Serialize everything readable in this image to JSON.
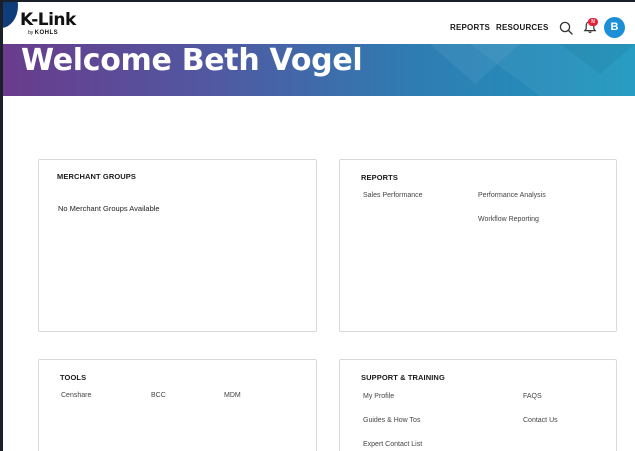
{
  "header": {
    "logo_main": "K-Link",
    "logo_prefix": "by",
    "logo_brand": "KOHLS",
    "nav": [
      "REPORTS",
      "RESOURCES"
    ],
    "notification_badge": "N",
    "avatar_initial": "B",
    "icons": [
      "search-icon",
      "bell-icon"
    ]
  },
  "banner": {
    "title": "Welcome Beth Vogel"
  },
  "merchant_groups": {
    "title": "MERCHANT GROUPS",
    "empty_text": "No Merchant Groups Available"
  },
  "reports": {
    "title": "REPORTS",
    "links": [
      "Sales Performance",
      "Performance Analysis",
      "Workflow Reporting"
    ]
  },
  "tools": {
    "title": "TOOLS",
    "links": [
      "Censhare",
      "BCC",
      "MDM"
    ]
  },
  "support": {
    "title": "SUPPORT & TRAINING",
    "links": [
      "My Profile",
      "FAQS",
      "Guides & How Tos",
      "Contact Us",
      "Expert Contact List"
    ]
  },
  "colors": {
    "accent_blue": "#1d8fd6",
    "badge_red": "#e3223a",
    "banner_start": "#6a3b8d",
    "banner_end": "#1d98bf"
  }
}
